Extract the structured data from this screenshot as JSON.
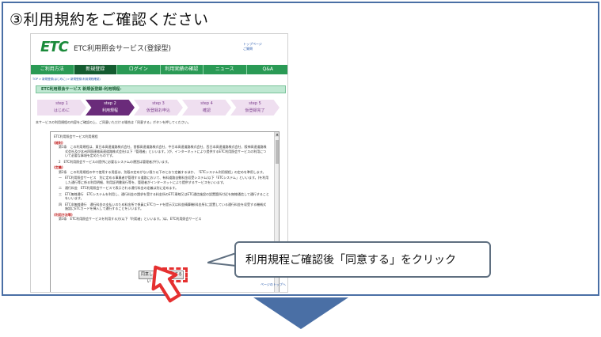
{
  "heading": "③利用規約をご確認ください",
  "site": {
    "logo": "ETC",
    "title": "ETC利用照会サービス(登録型)",
    "header_links": [
      "トップページ",
      "ご質問"
    ]
  },
  "nav": [
    "ご利用方法",
    "新規登録",
    "ログイン",
    "利用実績の確認",
    "ニュース",
    "Q&A"
  ],
  "breadcrumb": "TOP > 新規登録(はじめに) > 新規登録(利用規程確認)",
  "section_banner": "ETC利用照会サービス 新規仮登録-利用規程-",
  "steps": [
    {
      "num": "step 1",
      "name": "はじめに"
    },
    {
      "num": "step 2",
      "name": "利用規程"
    },
    {
      "num": "step 3",
      "name": "仮登録お申込"
    },
    {
      "num": "step 4",
      "name": "確認"
    },
    {
      "num": "step 5",
      "name": "仮登録完了"
    }
  ],
  "instruction": "本サービスの利用規程の内容をご確認の上、ご同意いただける場合は「同意する」ボタンを押してください。",
  "terms": {
    "title": "ETC利用照会サービス利用規程",
    "sec1": "(総則)",
    "p1": "第1条　この利用規程は、東日本高速道路株式会社、首都高速道路株式会社、中日本高速道路株式会社、西日本高速道路株式会社、阪神高速道路株式会社及び本州四国連絡高速道路株式会社(以下「管理者」といいます。)が、インターネットにより提供するETC利用照会サービスの利用について必要な事項を定めたものです。",
    "p2": "2　ETC利用照会サービスの提供に必要なシステムの運営は管理者が行います。",
    "sec2": "(定義)",
    "p3": "第2条　この利用規程の中で使用する用語は、別段の定めがない限り以下のとおり定義するほか、「ETCシステム利用規程」の定めを準用します。",
    "p4": "一　ETC利用照会サービス　別に定める事業者が管理する道路において、有料道路自動料金収受システム(以下「ETCシステム」といいます。)を利用した通行等に係る利用明細、利用証明書発行等を、管理者がインターネットにより提供するサービスをいいます。",
    "p5": "二　通行料金　ETC利用照会サービスで表示される通行料金の定義は別に定めます。",
    "p6": "三　ETC無線通行　ETCシステムを利用し、通行料金の請求を受ける料金所のETC車線又はETC通信施設の設置箇所付近を無線通信して通行することをいいます。",
    "p7": "四　ETC非無線通行　通行料金の支払いのため料金所で係員にETCカードを提示又は料金精算機(料金所)に設置している通行料金を収受する機械式施設にETCカードを挿入して通行することをいいます。",
    "sec3": "(利用方法等)",
    "p8": "第3条　ETC利用照会サービスを利用する方(以下「利用者」といいます。)は、ETC利用照会サービス"
  },
  "buttons": {
    "disagree": "同意しない",
    "agree": "同意する"
  },
  "pagetop": "ページのトップへ",
  "callout": "利用規程ご確認後「同意する」をクリック",
  "colors": {
    "frame": "#4a6fa5",
    "nav": "#2a9a55",
    "step_active": "#6a2b7a",
    "highlight": "#e53030"
  }
}
